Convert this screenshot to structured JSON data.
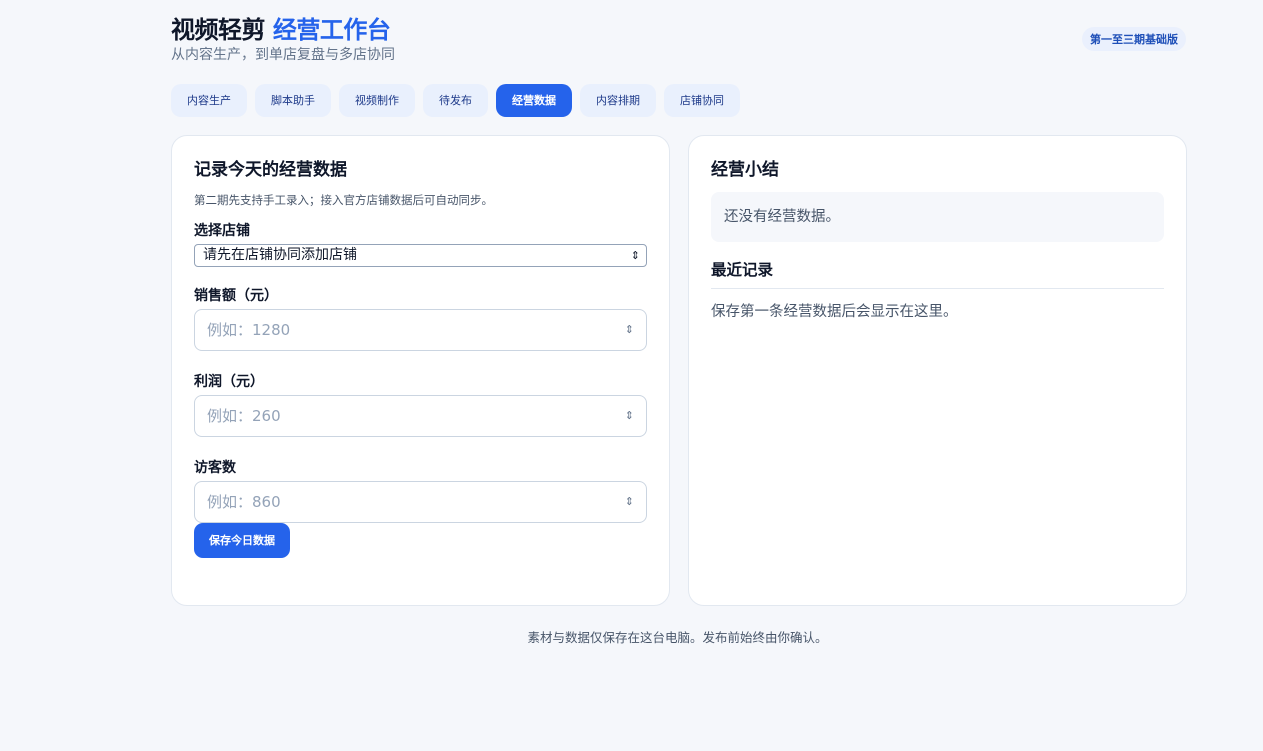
{
  "header": {
    "title_main": "视频轻剪",
    "title_accent": "经营工作台",
    "subtitle": "从内容生产，到单店复盘与多店协同",
    "version_badge": "第一至三期基础版"
  },
  "tabs": [
    {
      "label": "内容生产",
      "active": false
    },
    {
      "label": "脚本助手",
      "active": false
    },
    {
      "label": "视频制作",
      "active": false
    },
    {
      "label": "待发布",
      "active": false
    },
    {
      "label": "经营数据",
      "active": true
    },
    {
      "label": "内容排期",
      "active": false
    },
    {
      "label": "店铺协同",
      "active": false
    }
  ],
  "form": {
    "title": "记录今天的经营数据",
    "hint": "第二期先支持手工录入；接入官方店铺数据后可自动同步。",
    "store_label": "选择店铺",
    "store_value": "请先在店铺协同添加店铺",
    "sales_label": "销售额（元）",
    "sales_placeholder": "例如：1280",
    "profit_label": "利润（元）",
    "profit_placeholder": "例如：260",
    "visitors_label": "访客数",
    "visitors_placeholder": "例如：860",
    "save_label": "保存今日数据"
  },
  "summary": {
    "title": "经营小结",
    "empty_text": "还没有经营数据。",
    "recent_title": "最近记录",
    "recent_empty": "保存第一条经营数据后会显示在这里。"
  },
  "footer": {
    "text": "素材与数据仅保存在这台电脑。发布前始终由你确认。"
  },
  "colors": {
    "accent": "#2563eb",
    "tab_bg": "#e9f0fd",
    "page_bg": "#f5f7fb"
  }
}
